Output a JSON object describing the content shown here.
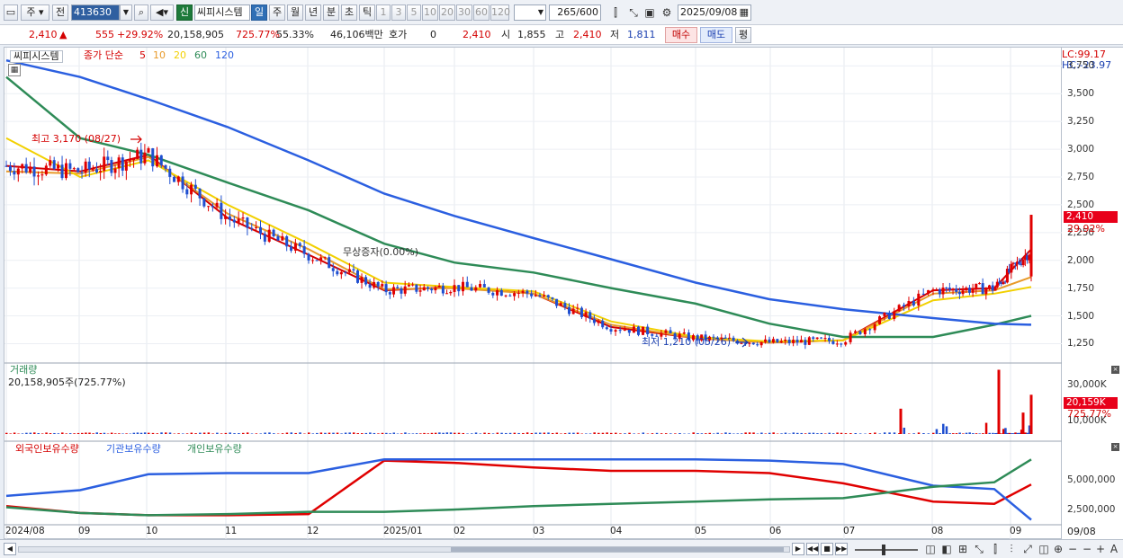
{
  "toolbar": {
    "period_unit": "주",
    "prev_label": "전",
    "stock_code": "413630",
    "new_badge": "신",
    "stock_name": "씨피시스템",
    "periods": [
      "일",
      "주",
      "월",
      "년",
      "분",
      "초",
      "틱"
    ],
    "period_selected": "일",
    "nums": [
      "1",
      "3",
      "5",
      "10",
      "20",
      "30",
      "60",
      "120"
    ],
    "count": "265",
    "count_total": "/600",
    "date": "2025/09/08"
  },
  "quote": {
    "price": "2,410",
    "change": "555",
    "change_pct": "+29.92%",
    "volume": "20,158,905",
    "vol_ratio": "725.77%",
    "turnover": "55.33%",
    "amount": "46,106백만",
    "hoga_label": "호가",
    "hoga_value": "0",
    "price2": "2,410",
    "open_label": "시",
    "open": "1,855",
    "high_label": "고",
    "high": "2,410",
    "low_label": "저",
    "low": "1,811",
    "buy_label": "매수",
    "sell_label": "매도",
    "eval_label": "평"
  },
  "price_panel": {
    "title": "씨피시스템",
    "ma_label": "종가 단순",
    "ma_periods": [
      "5",
      "10",
      "20",
      "60",
      "120"
    ],
    "lc": "LC:99.17",
    "hc": "HC:-23.97",
    "high_note": "최고 3,170 (08/27)",
    "low_note": "최저 1,210 (05/26)",
    "event_note": "무상증자(0.00%)",
    "price_tag": "2,410",
    "pct_tag": "29.92%",
    "y_ticks": [
      "3,750",
      "3,500",
      "3,250",
      "3,000",
      "2,750",
      "2,500",
      "2,250",
      "2,000",
      "1,750",
      "1,500",
      "1,250"
    ]
  },
  "volume_panel": {
    "title": "거래량",
    "value": "20,158,905주(725.77%)",
    "y_ticks": [
      "30,000K",
      "10,000K"
    ],
    "tag": "20,159K",
    "tag_pct": "725.77%"
  },
  "holder_panel": {
    "series": [
      {
        "name": "외국인보유수량",
        "color": "#e00000"
      },
      {
        "name": "기관보유수량",
        "color": "#2b5fe0"
      },
      {
        "name": "개인보유수량",
        "color": "#2e8b57"
      }
    ],
    "y_ticks": [
      "5,000,000",
      "2,500,000"
    ]
  },
  "x_axis": [
    "2024/08",
    "09",
    "10",
    "11",
    "12",
    "2025/01",
    "02",
    "03",
    "04",
    "05",
    "06",
    "07",
    "08",
    "09"
  ],
  "x_axis_end": "09/08",
  "chart_data": [
    {
      "type": "line",
      "panel": "price",
      "ylim": [
        1100,
        3850
      ],
      "x": [
        "2024/08",
        "2024/09",
        "2024/10",
        "2024/11",
        "2024/12",
        "2025/01",
        "2025/02",
        "2025/03",
        "2025/04",
        "2025/05",
        "2025/06",
        "2025/07",
        "2025/08",
        "2025/09",
        "2025/09/08"
      ],
      "series": [
        {
          "name": "5",
          "values": [
            2850,
            2800,
            2950,
            2380,
            2050,
            1730,
            1760,
            1700,
            1400,
            1300,
            1260,
            1280,
            1730,
            1750,
            2100
          ]
        },
        {
          "name": "10",
          "values": [
            2800,
            2780,
            2930,
            2420,
            2100,
            1740,
            1750,
            1700,
            1420,
            1300,
            1260,
            1280,
            1700,
            1730,
            1850
          ]
        },
        {
          "name": "20",
          "values": [
            3100,
            2750,
            2900,
            2500,
            2150,
            1800,
            1760,
            1720,
            1450,
            1310,
            1270,
            1280,
            1640,
            1700,
            1760
          ]
        },
        {
          "name": "60",
          "values": [
            3650,
            3100,
            2950,
            2700,
            2450,
            2150,
            1980,
            1890,
            1750,
            1610,
            1430,
            1310,
            1310,
            1420,
            1500
          ]
        },
        {
          "name": "120",
          "values": [
            3800,
            3650,
            3450,
            3200,
            2900,
            2600,
            2400,
            2200,
            2010,
            1800,
            1650,
            1560,
            1480,
            1430,
            1420
          ]
        }
      ]
    },
    {
      "type": "bar",
      "panel": "volume",
      "ylim": [
        0,
        36000
      ],
      "values_label_k": [
        "spikes near 2025/07 ~ 2025/09"
      ],
      "last_value_k": 20159
    },
    {
      "type": "line",
      "panel": "holders",
      "ylim": [
        1500000,
        7500000
      ],
      "series": [
        {
          "name": "외국인보유수량",
          "values": [
            2900000,
            2300000,
            2100000,
            2100000,
            2200000,
            6900000,
            6700000,
            6300000,
            6000000,
            6000000,
            5800000,
            4900000,
            3300000,
            3100000,
            4800000
          ]
        },
        {
          "name": "기관보유수량",
          "values": [
            3800000,
            4300000,
            5700000,
            5800000,
            5800000,
            7000000,
            7000000,
            7000000,
            7000000,
            7000000,
            6900000,
            6600000,
            4700000,
            4400000,
            1700000
          ]
        },
        {
          "name": "개인보유수량",
          "values": [
            2800000,
            2300000,
            2100000,
            2200000,
            2400000,
            2400000,
            2600000,
            2900000,
            3100000,
            3300000,
            3500000,
            3600000,
            4600000,
            5000000,
            7000000
          ]
        }
      ]
    }
  ]
}
